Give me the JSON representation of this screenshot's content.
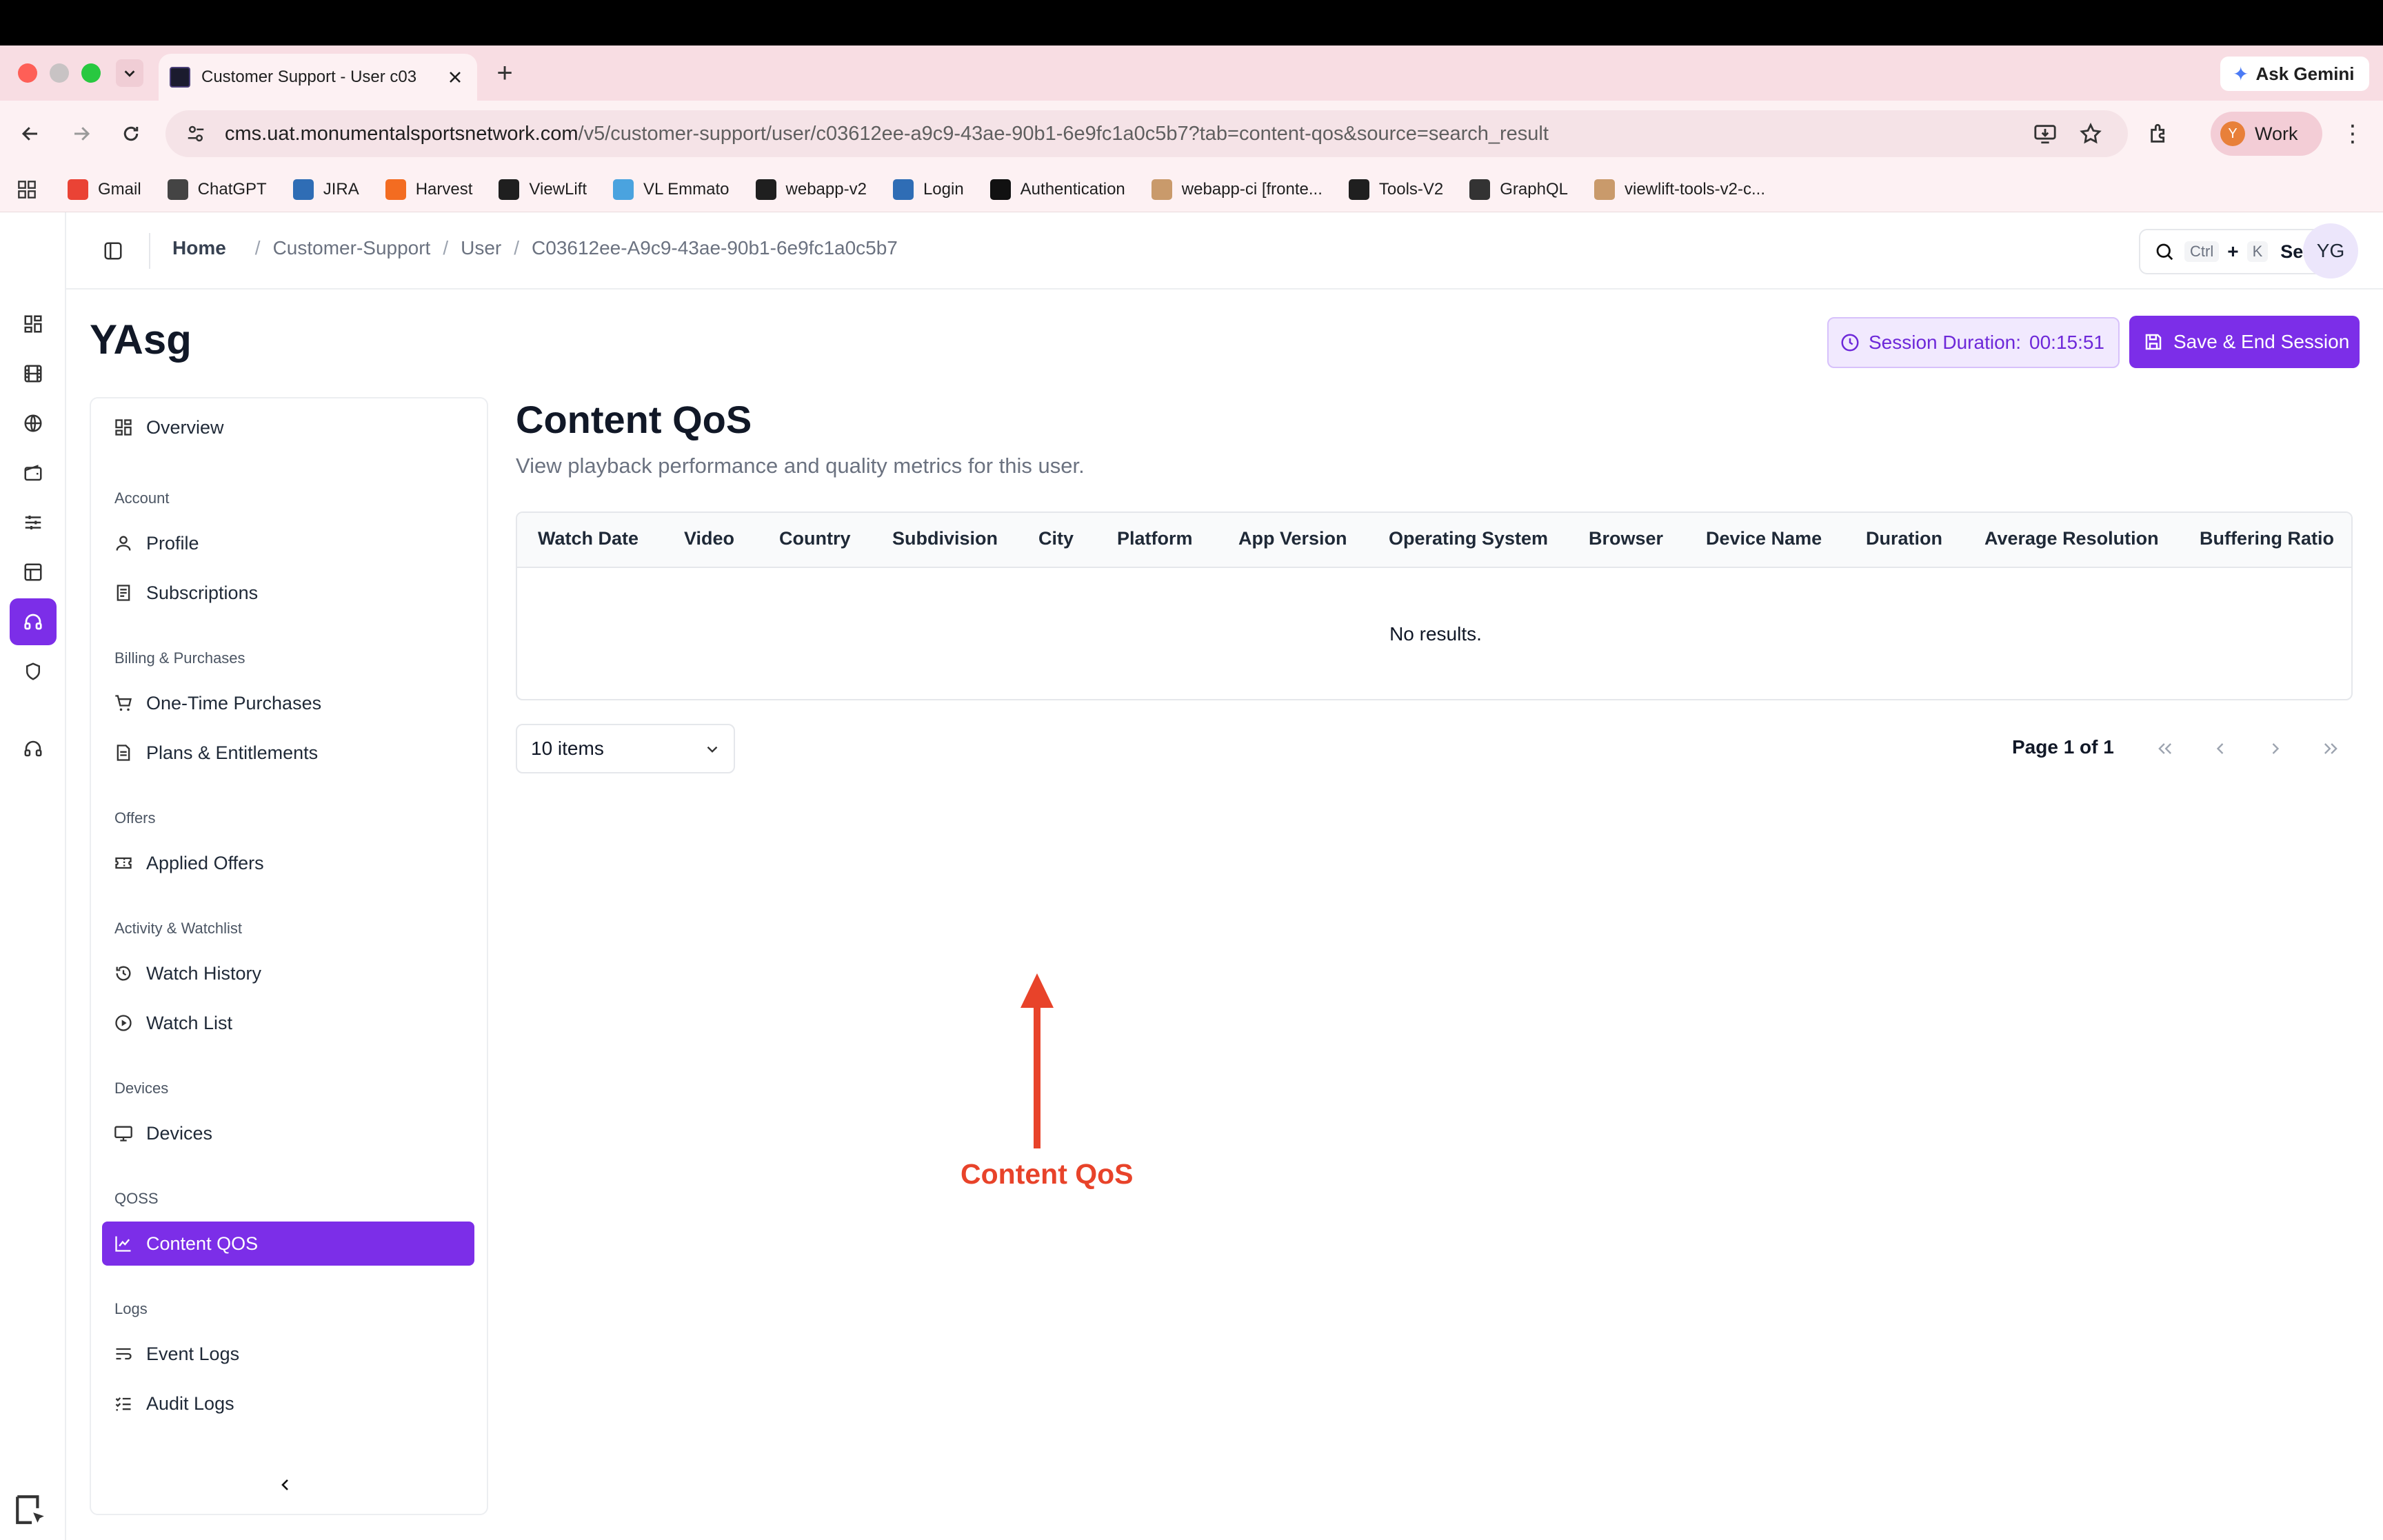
{
  "browser": {
    "tab_title": "Customer Support - User c03",
    "new_tab": "+",
    "ask_gemini": "Ask Gemini",
    "url_host": "cms.uat.monumentalsportsnetwork.com",
    "url_path": "/v5/customer-support/user/c03612ee-a9c9-43ae-90b1-6e9fc1a0c5b7?tab=content-qos&source=search_result",
    "profile_initial": "Y",
    "profile_name": "Work",
    "bookmarks": [
      {
        "label": "Gmail",
        "icon": "gmail-icon",
        "color": "#ea4335"
      },
      {
        "label": "ChatGPT",
        "icon": "chatgpt-icon",
        "color": "#444444"
      },
      {
        "label": "JIRA",
        "icon": "jira-icon",
        "color": "#2f6db5"
      },
      {
        "label": "Harvest",
        "icon": "harvest-icon",
        "color": "#f36c21"
      },
      {
        "label": "ViewLift",
        "icon": "github-icon",
        "color": "#1f1f1f"
      },
      {
        "label": "VL Emmato",
        "icon": "emmato-icon",
        "color": "#4aa3df"
      },
      {
        "label": "webapp-v2",
        "icon": "github-icon",
        "color": "#1f1f1f"
      },
      {
        "label": "Login",
        "icon": "login-icon",
        "color": "#2f6db5"
      },
      {
        "label": "Authentication",
        "icon": "auth-icon",
        "color": "#111111"
      },
      {
        "label": "webapp-ci [fronte...",
        "icon": "jenkins-icon",
        "color": "#c99a6b"
      },
      {
        "label": "Tools-V2",
        "icon": "github-icon",
        "color": "#1f1f1f"
      },
      {
        "label": "GraphQL",
        "icon": "globe-icon",
        "color": "#333333"
      },
      {
        "label": "viewlift-tools-v2-c...",
        "icon": "jenkins-icon",
        "color": "#c99a6b"
      }
    ]
  },
  "header": {
    "breadcrumb": [
      "Home",
      "Customer-Support",
      "User",
      "C03612ee-A9c9-43ae-90b1-6e9fc1a0c5b7"
    ],
    "search": {
      "kbd_ctrl": "Ctrl",
      "kbd_plus": "+",
      "kbd_k": "K",
      "label": "Search"
    },
    "avatar": "YG"
  },
  "page": {
    "user_name": "YAsg",
    "session_label": "Session Duration:",
    "session_value": "00:15:51",
    "save_label": "Save & End Session"
  },
  "nav": {
    "overview": "Overview",
    "groups": {
      "account": "Account",
      "billing": "Billing & Purchases",
      "offers": "Offers",
      "activity": "Activity & Watchlist",
      "devices": "Devices",
      "qoss": "QOSS",
      "logs": "Logs"
    },
    "items": {
      "profile": "Profile",
      "subscriptions": "Subscriptions",
      "one_time": "One-Time Purchases",
      "plans": "Plans & Entitlements",
      "applied_offers": "Applied Offers",
      "watch_history": "Watch History",
      "watch_list": "Watch List",
      "devices": "Devices",
      "content_qos": "Content QOS",
      "event_logs": "Event Logs",
      "audit_logs": "Audit Logs"
    }
  },
  "content": {
    "title": "Content QoS",
    "subtitle": "View playback performance and quality metrics for this user.",
    "columns": [
      "Watch Date",
      "Video",
      "Country",
      "Subdivision",
      "City",
      "Platform",
      "App Version",
      "Operating System",
      "Browser",
      "Device Name",
      "Duration",
      "Average Resolution",
      "Buffering Ratio"
    ],
    "empty_text": "No results.",
    "page_size": "10 items",
    "page_info": "Page 1 of 1"
  },
  "annotation": {
    "label": "Content QoS",
    "color": "#e8432a"
  },
  "colors": {
    "accent": "#7c2ee8",
    "tabstrip": "#f8dde3"
  }
}
